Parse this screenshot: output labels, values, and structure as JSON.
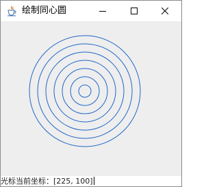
{
  "window": {
    "title": "绘制同心圆",
    "app_icon": "java-coffee-cup-icon",
    "controls": {
      "minimize_icon": "minimize-icon",
      "maximize_icon": "maximize-icon",
      "close_icon": "close-icon"
    }
  },
  "canvas": {
    "background": "#eeeeee",
    "circle_color": "#1f66c8",
    "circle_count": 7
  },
  "status": {
    "label": "光标当前坐标：",
    "value": "[225, 100]"
  }
}
